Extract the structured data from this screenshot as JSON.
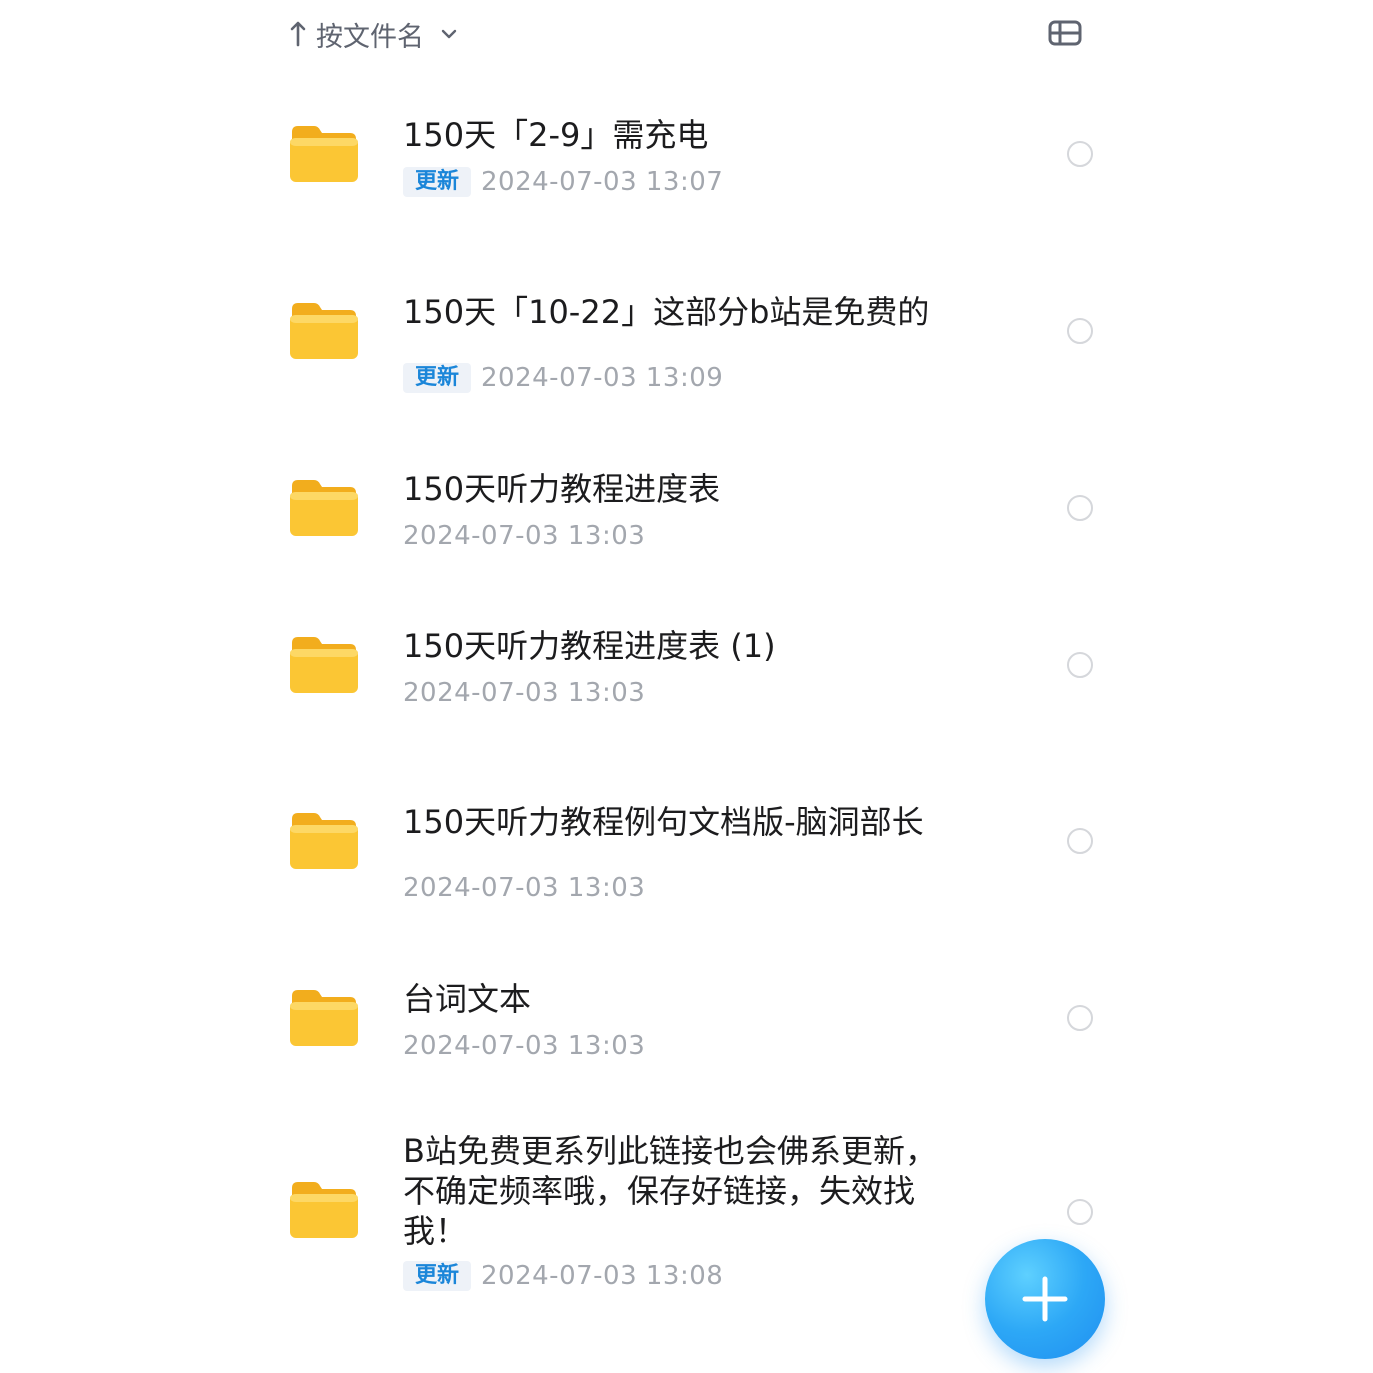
{
  "sort_bar": {
    "label": "按文件名",
    "arrow_icon": "arrow-up-icon",
    "dropdown_icon": "chevron-down-icon"
  },
  "view_toggle_icon": "list-view-icon",
  "colors": {
    "badge_text": "#1b86d9",
    "badge_bg": "#eef2f8",
    "date_text": "#a3a7ae",
    "folder": "#fbc634",
    "fab": "#2da8f6"
  },
  "files": [
    {
      "name": "150天「2-9」需充电",
      "badge": "更新",
      "date": "2024-07-03 13:07"
    },
    {
      "name": "150天「10-22」这部分b站是免费的",
      "badge": "更新",
      "date": "2024-07-03 13:09"
    },
    {
      "name": "150天听力教程进度表",
      "badge": "",
      "date": "2024-07-03 13:03"
    },
    {
      "name": "150天听力教程进度表 (1)",
      "badge": "",
      "date": "2024-07-03 13:03"
    },
    {
      "name": "150天听力教程例句文档版-脑洞部长",
      "badge": "",
      "date": "2024-07-03 13:03"
    },
    {
      "name": "台词文本",
      "badge": "",
      "date": "2024-07-03 13:03"
    },
    {
      "name": "B站免费更系列此链接也会佛系更新，不确定频率哦，保存好链接，失效找我！",
      "badge": "更新",
      "date": "2024-07-03 13:08"
    }
  ],
  "fab_icon": "plus-icon"
}
